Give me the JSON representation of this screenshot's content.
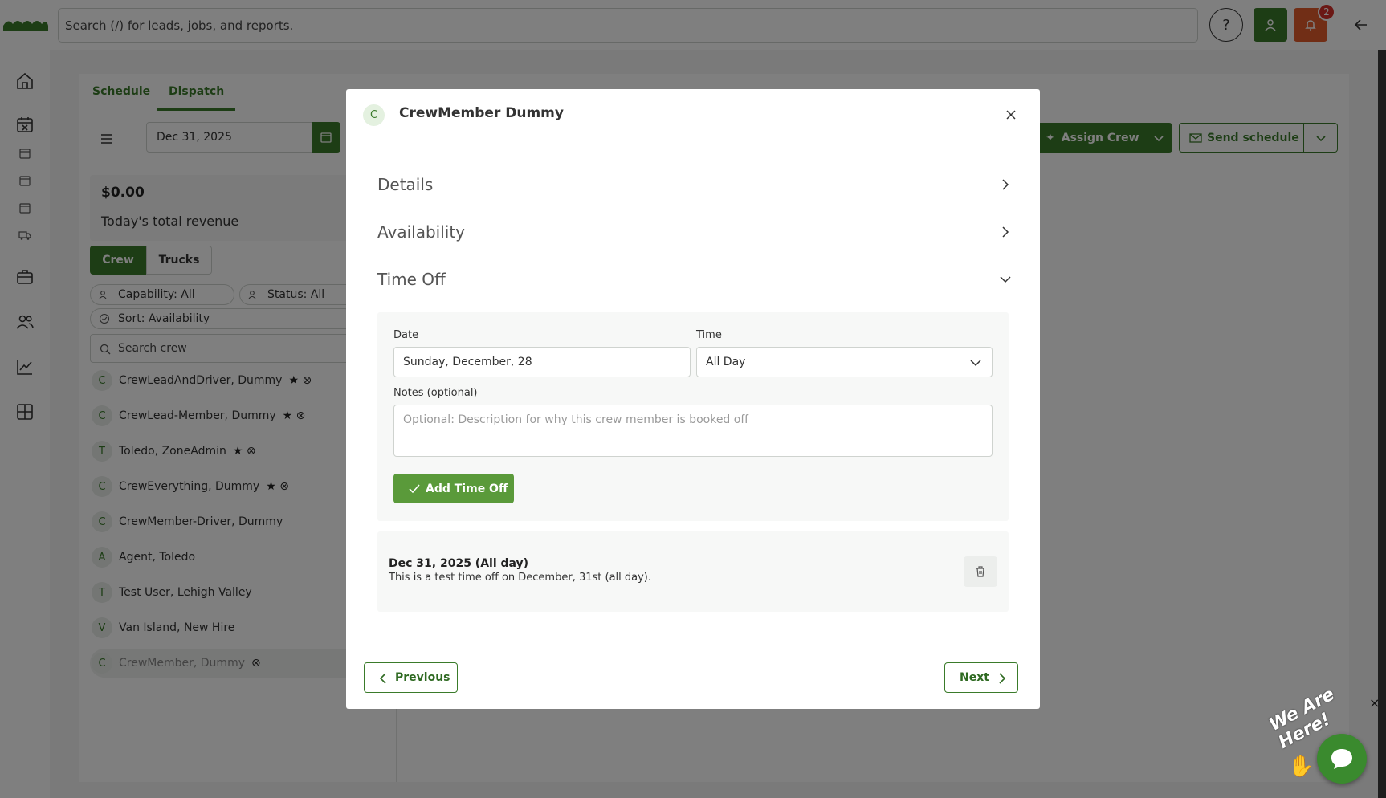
{
  "topbar": {
    "search_placeholder": "Search (/) for leads, jobs, and reports.",
    "help_label": "?",
    "notification_count": "2"
  },
  "tabs": [
    {
      "label": "Schedule"
    },
    {
      "label": "Dispatch"
    }
  ],
  "toolbar": {
    "date": "Dec 31, 2025",
    "assign_crew_label": "Assign Crew",
    "send_schedule_label": "Send schedule"
  },
  "revenue": {
    "value": "$0.00",
    "label": "Today's total revenue"
  },
  "segment": {
    "crew_label": "Crew",
    "trucks_label": "Trucks"
  },
  "filters": {
    "capability": "Capability: All",
    "status": "Status: All",
    "sort": "Sort: Availability",
    "search_placeholder": "Search crew"
  },
  "crew_list": [
    {
      "initial": "C",
      "name": "CrewLeadAndDriver, Dummy",
      "badge": "★ ⊗"
    },
    {
      "initial": "C",
      "name": "CrewLead-Member, Dummy",
      "badge": "★ ⊗"
    },
    {
      "initial": "T",
      "name": "Toledo, ZoneAdmin",
      "badge": "★ ⊗"
    },
    {
      "initial": "C",
      "name": "CrewEverything, Dummy",
      "badge": "★ ⊗"
    },
    {
      "initial": "C",
      "name": "CrewMember-Driver, Dummy",
      "badge": ""
    },
    {
      "initial": "A",
      "name": "Agent, Toledo",
      "badge": ""
    },
    {
      "initial": "T",
      "name": "Test User, Lehigh Valley",
      "badge": ""
    },
    {
      "initial": "V",
      "name": "Van Island, New Hire",
      "badge": ""
    },
    {
      "initial": "C",
      "name": "CrewMember, Dummy",
      "badge": "⊗"
    }
  ],
  "modal": {
    "avatar_initial": "C",
    "title": "CrewMember Dummy",
    "sections": {
      "details": "Details",
      "availability": "Availability",
      "time_off": "Time Off"
    },
    "form": {
      "date_label": "Date",
      "date_value": "Sunday, December, 28",
      "time_label": "Time",
      "time_value": "All Day",
      "notes_label": "Notes (optional)",
      "notes_placeholder": "Optional: Description for why this crew member is booked off",
      "add_button": "Add Time Off"
    },
    "entry": {
      "title": "Dec 31, 2025 (All day)",
      "description": "This is a test time off on December, 31st (all day)."
    },
    "previous_label": "Previous",
    "next_label": "Next"
  },
  "chat": {
    "tagline": "We Are Here!",
    "close_label": "×"
  },
  "colors": {
    "brand_green": "#3a7b2a",
    "alert_orange": "#e35d2c",
    "badge_red": "#d6312b"
  }
}
